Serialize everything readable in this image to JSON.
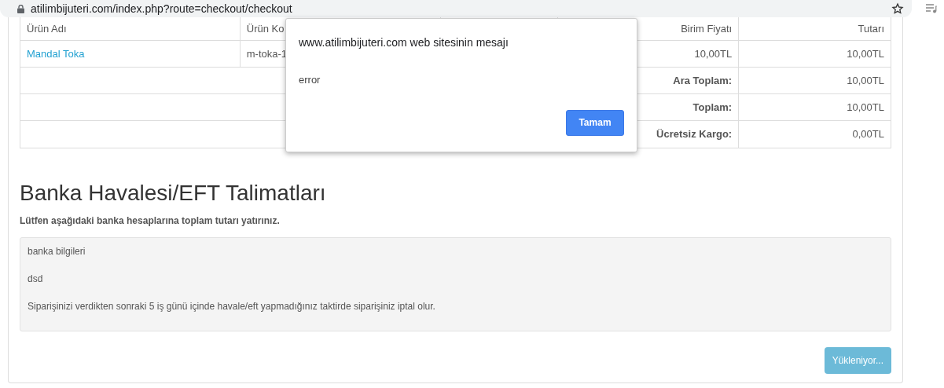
{
  "browser": {
    "url": "atilimbijuteri.com/index.php?route=checkout/checkout"
  },
  "table": {
    "columns": [
      "Ürün Adı",
      "Ürün Ko",
      "",
      "Birim Fiyatı",
      "Tutarı"
    ],
    "rows": [
      {
        "kind": "item",
        "cells": [
          "Mandal Toka",
          "m-toka-1",
          "",
          "10,00TL",
          "10,00TL"
        ]
      }
    ],
    "totals": [
      {
        "label": "Ara Toplam:",
        "value": "10,00TL"
      },
      {
        "label": "Toplam:",
        "value": "10,00TL"
      },
      {
        "label": "Ücretsiz Kargo:",
        "value": "0,00TL"
      }
    ]
  },
  "payment": {
    "title": "Banka Havalesi/EFT Talimatları",
    "subtitle": "Lütfen aşağıdaki banka hesaplarına toplam tutarı yatırınız.",
    "lines": [
      "banka bilgileri",
      "dsd",
      "Siparişinizi verdikten sonraki 5 iş günü içinde havale/eft yapmadığınız taktirde siparişiniz iptal olur."
    ],
    "button": {
      "label": "Yükleniyor...",
      "disabled": true
    }
  },
  "dialog": {
    "title": "www.atilimbijuteri.com web sitesinin mesajı",
    "message": "error",
    "button": "Tamam"
  }
}
